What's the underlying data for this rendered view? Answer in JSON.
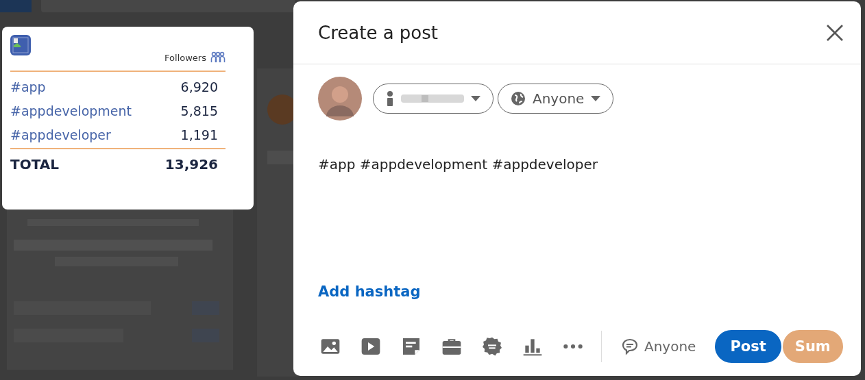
{
  "followers_card": {
    "header": "Followers",
    "rows": [
      {
        "tag": "#app",
        "count": "6,920"
      },
      {
        "tag": "#appdevelopment",
        "count": "5,815"
      },
      {
        "tag": "#appdeveloper",
        "count": "1,191"
      }
    ],
    "total": {
      "label": "TOTAL",
      "count": "13,926"
    }
  },
  "post_dialog": {
    "title": "Create a post",
    "visibility": "Anyone",
    "text": "#app #appdevelopment #appdeveloper",
    "add_hashtag": "Add hashtag",
    "comment_setting": "Anyone",
    "buttons": [
      {
        "label": "Post",
        "kind": "primary"
      },
      {
        "label": "Sum",
        "kind": "secondary"
      }
    ]
  }
}
